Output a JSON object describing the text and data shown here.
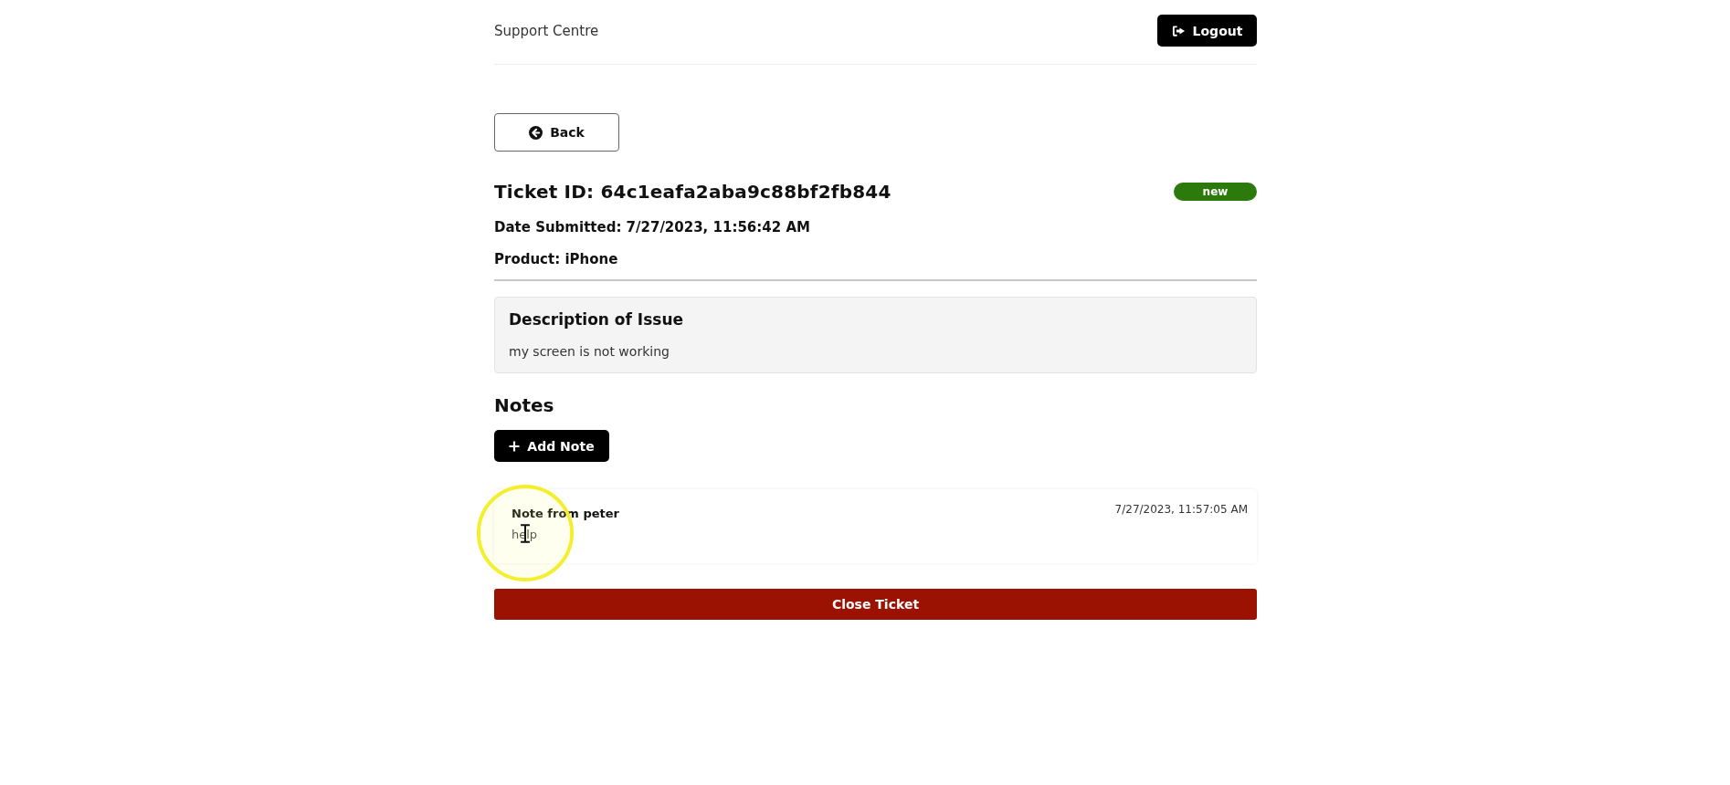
{
  "header": {
    "title": "Support Centre",
    "logout_button": "Logout"
  },
  "back_button": "Back",
  "ticket": {
    "id_line": "Ticket ID: 64c1eafa2aba9c88bf2fb844",
    "status": {
      "label": "new",
      "color": "#2b7a0b"
    },
    "date_line": "Date Submitted: 7/27/2023, 11:56:42 AM",
    "product_line": "Product: iPhone"
  },
  "description": {
    "heading": "Description of Issue",
    "text": "my screen is not working"
  },
  "notes": {
    "heading": "Notes",
    "add_button": "Add Note",
    "items": [
      {
        "author_line": "Note from peter",
        "date": "7/27/2023, 11:57:05 AM",
        "text": "help"
      }
    ]
  },
  "close_button": "Close Ticket"
}
